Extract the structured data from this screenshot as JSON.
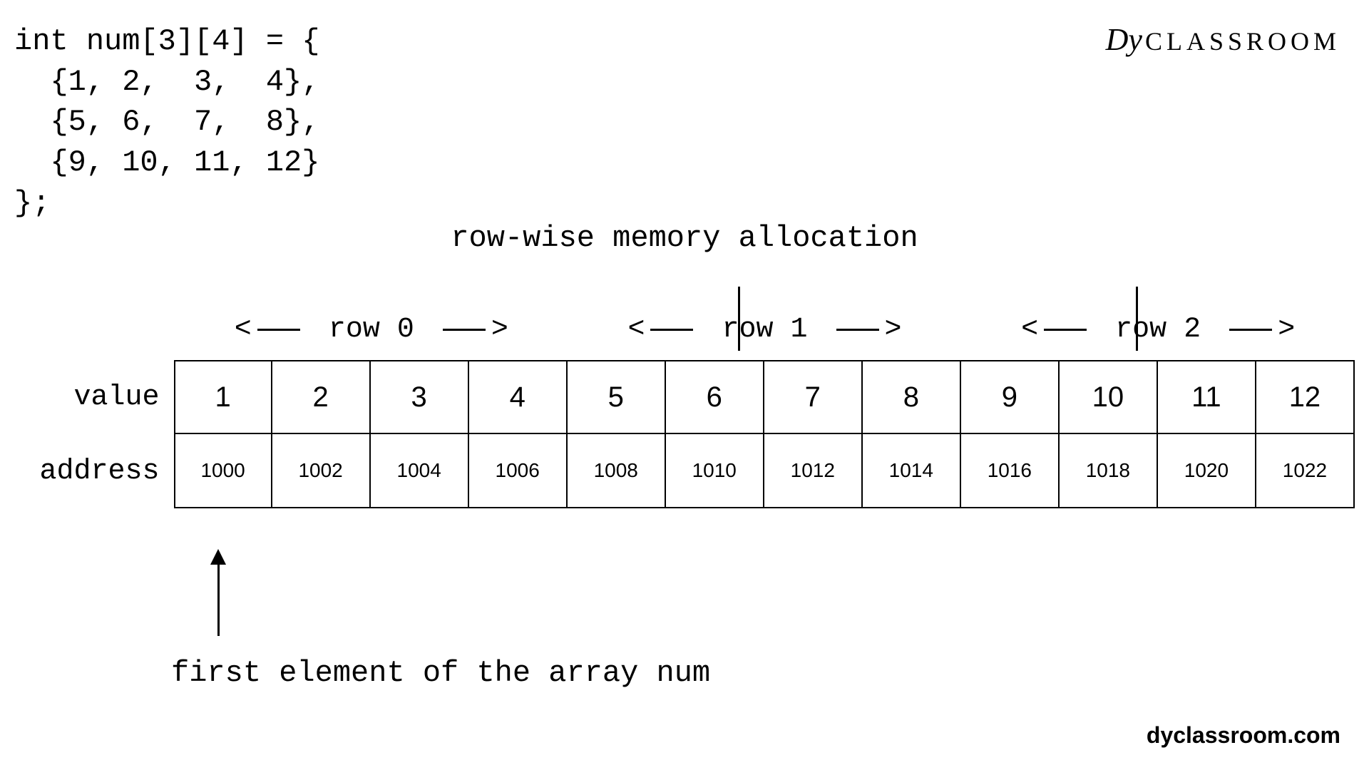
{
  "code": "int num[3][4] = {\n  {1, 2,  3,  4},\n  {5, 6,  7,  8},\n  {9, 10, 11, 12}\n};",
  "title": "row-wise memory allocation",
  "logo": {
    "script": "Dy",
    "text": "CLASSROOM"
  },
  "rowHeaders": [
    "row 0",
    "row 1",
    "row 2"
  ],
  "labels": {
    "value": "value",
    "address": "address"
  },
  "pointerLabel": "first element of the array num",
  "footer": "dyclassroom.com",
  "chart_data": {
    "type": "table",
    "title": "row-wise memory allocation",
    "columns": [
      "value",
      "address",
      "row"
    ],
    "rows": [
      [
        1,
        1000,
        0
      ],
      [
        2,
        1002,
        0
      ],
      [
        3,
        1004,
        0
      ],
      [
        4,
        1006,
        0
      ],
      [
        5,
        1008,
        1
      ],
      [
        6,
        1010,
        1
      ],
      [
        7,
        1012,
        1
      ],
      [
        8,
        1014,
        1
      ],
      [
        9,
        1016,
        2
      ],
      [
        10,
        1018,
        2
      ],
      [
        11,
        1020,
        2
      ],
      [
        12,
        1022,
        2
      ]
    ],
    "array_declaration": "int num[3][4]",
    "annotation": "first element of the array num points to address 1000"
  }
}
